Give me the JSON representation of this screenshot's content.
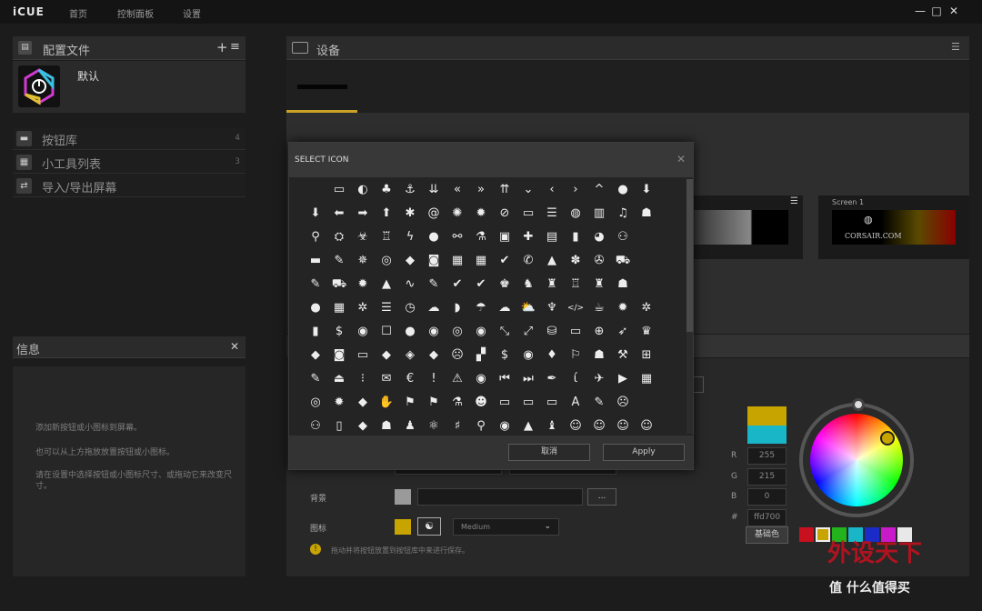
{
  "app": {
    "brand": "iCUE",
    "nav": [
      "首页",
      "控制面板",
      "设置"
    ],
    "window_buttons": [
      "minimize",
      "maximize",
      "close"
    ]
  },
  "profiles": {
    "title": "配置文件",
    "add_icon": "+",
    "menu_icon": "≡",
    "profile_name": "默认"
  },
  "sidebar": {
    "items": [
      {
        "label": "按钮库",
        "count": "4"
      },
      {
        "label": "小工具列表",
        "count": "3"
      },
      {
        "label": "导入/导出屏幕",
        "count": ""
      }
    ]
  },
  "info": {
    "title": "信息",
    "close": "✕",
    "lines": [
      "添加新按钮或小图标到屏幕。",
      "也可以从上方拖放放置按钮或小图标。",
      "请在设置中选择按钮或小图标尺寸、或拖动它来改变尺寸。"
    ]
  },
  "devices": {
    "title": "设备",
    "screen_label": "Screen 1",
    "screen_logo": "CORSAIR.COM"
  },
  "dialog": {
    "title": "SELECT ICON",
    "close": "✕",
    "cancel": "取消",
    "apply": "Apply",
    "icons": [
      [
        "",
        "▭",
        "◐",
        "♣",
        "⚓",
        "⇊",
        "«",
        "»",
        "⇈",
        "⌄",
        "‹",
        "›",
        "^",
        "●",
        "⬇"
      ],
      [
        "⬇",
        "⬅",
        "➡",
        "⬆",
        "✱",
        "@",
        "✺",
        "✹",
        "⊘",
        "▭",
        "☰",
        "◍",
        "▥",
        "♫",
        "☗"
      ],
      [
        "⚲",
        "⛭",
        "☣",
        "♖",
        "ϟ",
        "●",
        "⚯",
        "⚗",
        "▣",
        "✚",
        "▤",
        "▮",
        "◕",
        "⚇"
      ],
      [
        "▬",
        "✎",
        "✵",
        "◎",
        "◆",
        "◙",
        "▦",
        "▦",
        "✔",
        "✆",
        "▲",
        "✽",
        "✇",
        "⛟"
      ],
      [
        "✎",
        "⛟",
        "✹",
        "▲",
        "∿",
        "✎",
        "✔",
        "✔",
        "♚",
        "♞",
        "♜",
        "♖",
        "♜",
        "☗"
      ],
      [
        "●",
        "▦",
        "✲",
        "☰",
        "◷",
        "☁",
        "◗",
        "☂",
        "☁",
        "⛅",
        "♆",
        "</>",
        "☕",
        "✹",
        "✲"
      ],
      [
        "▮",
        "$",
        "◉",
        "☐",
        "●",
        "◉",
        "◎",
        "◉",
        "⤡",
        "⤢",
        "⛁",
        "▭",
        "⊕",
        "➶",
        "♛"
      ],
      [
        "◆",
        "◙",
        "▭",
        "◆",
        "◈",
        "◆",
        "☹",
        "▞",
        "$",
        "◉",
        "♦",
        "⚐",
        "☗",
        "⚒",
        "⊞"
      ],
      [
        "✎",
        "⏏",
        "⁝",
        "✉",
        "€",
        "!",
        "⚠",
        "◉",
        "⏮",
        "⏭",
        "✒",
        "ί",
        "✈",
        "▶",
        "▦"
      ],
      [
        "◎",
        "✹",
        "◆",
        "✋",
        "⚑",
        "⚑",
        "⚗",
        "☻",
        "▭",
        "▭",
        "▭",
        "A",
        "✎",
        "☹",
        ""
      ],
      [
        "⚇",
        "▯",
        "◆",
        "☗",
        "♟",
        "⚛",
        "♯",
        "⚲",
        "◉",
        "▲",
        "♝",
        "☺",
        "☺",
        "☺",
        "☺"
      ]
    ]
  },
  "settings": {
    "background_label": "背景",
    "icon_label": "图标",
    "size_value": "Medium",
    "ellipsis": "...",
    "hint": "拖动并将按钮放置到按钮库中来进行保存。"
  },
  "colorpicker": {
    "r_label": "R",
    "r": "255",
    "g_label": "G",
    "g": "215",
    "b_label": "B",
    "b": "0",
    "hex_label": "#",
    "hex": "ffd700",
    "base_label": "基础色",
    "current": "#c8a400",
    "previous": "#19b6c8",
    "swatches": [
      "#c8101e",
      "#c8a400",
      "#23b31d",
      "#19b6c8",
      "#1b2bc8",
      "#c81ac8",
      "#e8e8e8"
    ]
  },
  "watermark": {
    "text": "外设天下",
    "sub": "值 什么值得买"
  }
}
